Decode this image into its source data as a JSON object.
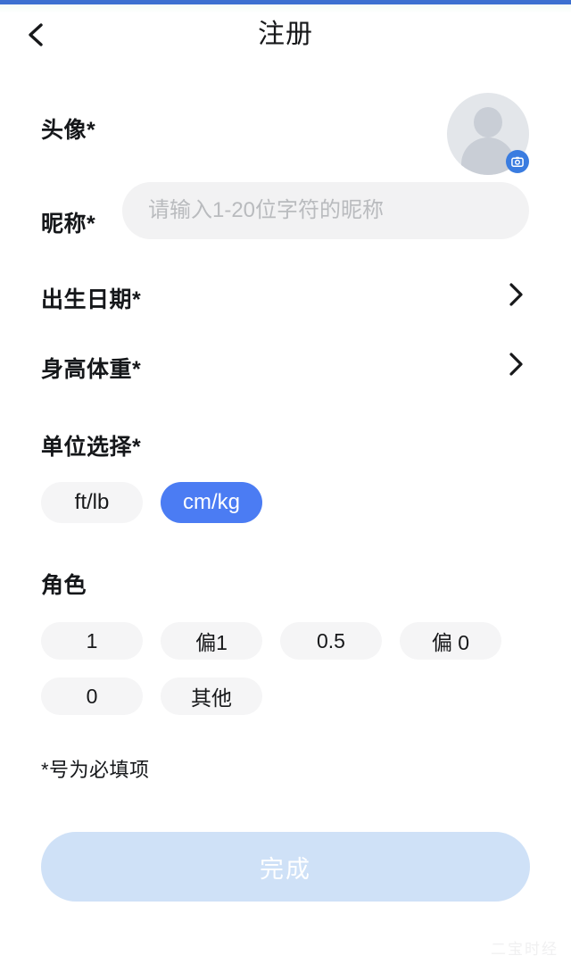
{
  "theme": {
    "status_bar_color": "#3c6fd0",
    "accent_color": "#4b7cf3",
    "chip_bg_color": "#f5f5f6",
    "input_bg_color": "#f2f2f3",
    "submit_disabled_color": "#cfe1f7",
    "text_color": "#15171a",
    "placeholder_color": "#b9bbbe"
  },
  "header": {
    "title": "注册",
    "back_icon": "chevron-left-icon"
  },
  "form": {
    "avatar": {
      "label": "头像*",
      "placeholder_icon": "person-silhouette-icon",
      "badge_icon": "camera-icon"
    },
    "nickname": {
      "label": "昵称*",
      "value": "",
      "placeholder": "请输入1-20位字符的昵称"
    },
    "birthdate": {
      "label": "出生日期*",
      "value": "",
      "chevron_icon": "chevron-right-icon"
    },
    "height_weight": {
      "label": "身高体重*",
      "value": "",
      "chevron_icon": "chevron-right-icon"
    },
    "unit_select": {
      "label": "单位选择*",
      "options": [
        {
          "label": "ft/lb",
          "selected": false
        },
        {
          "label": "cm/kg",
          "selected": true
        }
      ]
    },
    "role": {
      "label": "角色",
      "options": [
        {
          "label": "1",
          "selected": false
        },
        {
          "label": "偏1",
          "selected": false
        },
        {
          "label": "0.5",
          "selected": false
        },
        {
          "label": "偏 0",
          "selected": false
        },
        {
          "label": "0",
          "selected": false
        },
        {
          "label": "其他",
          "selected": false
        }
      ]
    },
    "required_note": "*号为必填项",
    "submit": {
      "label": "完成",
      "enabled": false
    }
  },
  "watermark": {
    "text": "二宝时经"
  }
}
